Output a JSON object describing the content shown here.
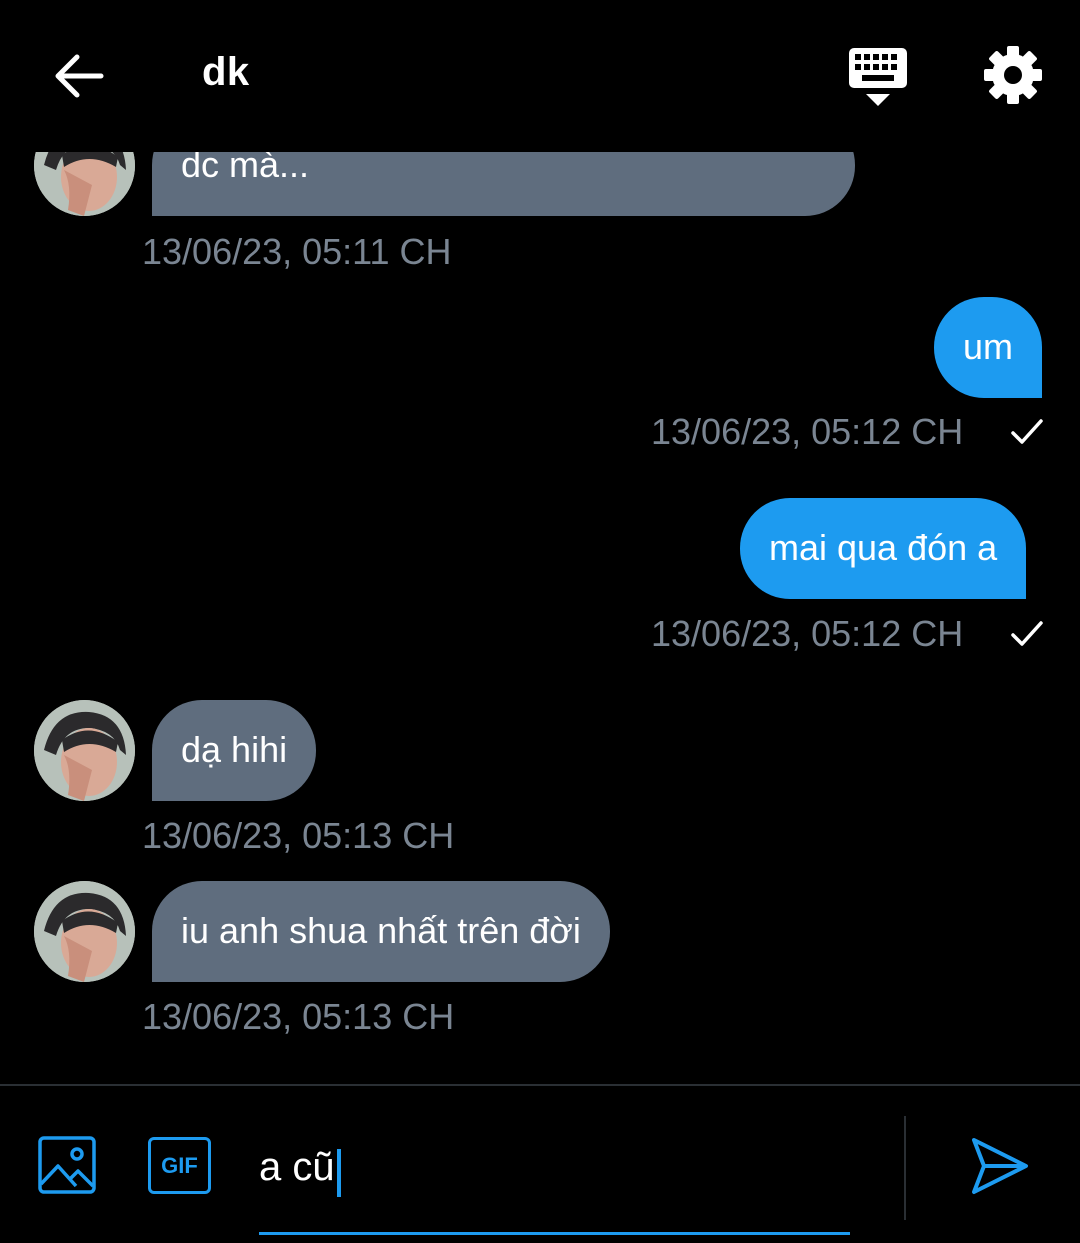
{
  "header": {
    "title": "dk",
    "back_icon": "arrow-left-icon",
    "keyboard_icon": "keyboard-icon",
    "settings_icon": "gear-icon"
  },
  "messages": [
    {
      "direction": "incoming",
      "text": "dc mà...",
      "timestamp": "13/06/23, 05:11 CH"
    },
    {
      "direction": "outgoing",
      "text": "um",
      "timestamp": "13/06/23, 05:12 CH",
      "status": "sent"
    },
    {
      "direction": "outgoing",
      "text": "mai qua đón a",
      "timestamp": "13/06/23, 05:12 CH",
      "status": "sent"
    },
    {
      "direction": "incoming",
      "text": "dạ hihi",
      "timestamp": "13/06/23, 05:13 CH"
    },
    {
      "direction": "incoming",
      "text": "iu anh shua nhất trên đời",
      "timestamp": "13/06/23, 05:13 CH"
    }
  ],
  "composer": {
    "input_value": "a cũ",
    "gif_label": "GIF",
    "image_icon": "image-icon",
    "send_icon": "send-icon"
  },
  "colors": {
    "background": "#000000",
    "outgoing_bubble": "#1d9bf0",
    "incoming_bubble": "#5f6d7e",
    "timestamp": "#7a8592",
    "accent": "#1d9bf0"
  }
}
